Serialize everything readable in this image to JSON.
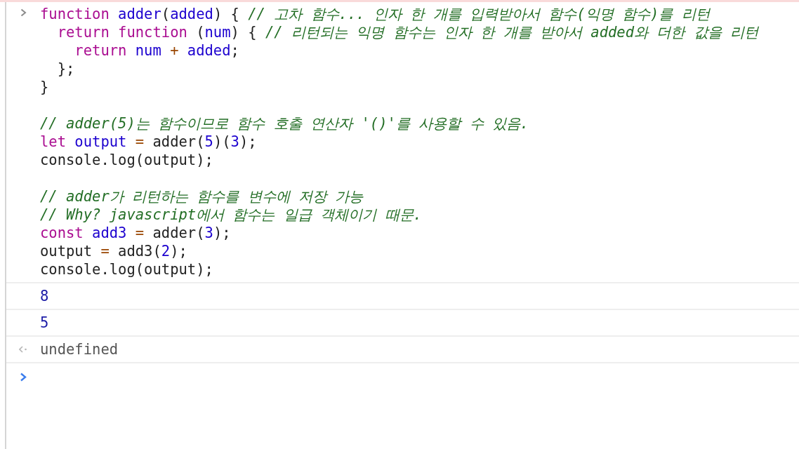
{
  "input": {
    "blocks": [
      [
        [
          {
            "kind": "keyword",
            "text": "function"
          },
          {
            "kind": "def",
            "text": " adder"
          },
          {
            "kind": "plain",
            "text": "("
          },
          {
            "kind": "def",
            "text": "added"
          },
          {
            "kind": "plain",
            "text": ") { "
          },
          {
            "kind": "comment",
            "text": "// 고차 함수... 인자 한 개를 입력받아서 함수(익명 함수)를 리턴"
          }
        ],
        [
          {
            "kind": "keyword",
            "text": "  return function"
          },
          {
            "kind": "plain",
            "text": " ("
          },
          {
            "kind": "def",
            "text": "num"
          },
          {
            "kind": "plain",
            "text": ") { "
          },
          {
            "kind": "comment",
            "text": "// 리턴되는 익명 함수는 인자 한 개를 받아서 added와 더한 값을 리턴"
          }
        ],
        [
          {
            "kind": "keyword",
            "text": "    return"
          },
          {
            "kind": "def",
            "text": " num"
          },
          {
            "kind": "operator",
            "text": " + "
          },
          {
            "kind": "def",
            "text": "added"
          },
          {
            "kind": "plain",
            "text": ";"
          }
        ],
        [
          {
            "kind": "plain",
            "text": "  };"
          }
        ],
        [
          {
            "kind": "plain",
            "text": "}"
          }
        ]
      ],
      [
        [
          {
            "kind": "comment",
            "text": "// adder(5)는 함수이므로 함수 호출 연산자 '()'를 사용할 수 있음."
          }
        ],
        [
          {
            "kind": "keyword",
            "text": "let"
          },
          {
            "kind": "def",
            "text": " output"
          },
          {
            "kind": "operator",
            "text": " = "
          },
          {
            "kind": "plain",
            "text": "adder("
          },
          {
            "kind": "number",
            "text": "5"
          },
          {
            "kind": "plain",
            "text": ")("
          },
          {
            "kind": "number",
            "text": "3"
          },
          {
            "kind": "plain",
            "text": ");"
          }
        ],
        [
          {
            "kind": "plain",
            "text": "console.log(output);"
          }
        ]
      ],
      [
        [
          {
            "kind": "comment",
            "text": "// adder가 리턴하는 함수를 변수에 저장 가능"
          }
        ],
        [
          {
            "kind": "comment",
            "text": "// Why? javascript에서 함수는 일급 객체이기 때문."
          }
        ],
        [
          {
            "kind": "keyword",
            "text": "const"
          },
          {
            "kind": "def",
            "text": " add3"
          },
          {
            "kind": "operator",
            "text": " = "
          },
          {
            "kind": "plain",
            "text": "adder("
          },
          {
            "kind": "number",
            "text": "3"
          },
          {
            "kind": "plain",
            "text": ");"
          }
        ],
        [
          {
            "kind": "plain",
            "text": "output"
          },
          {
            "kind": "operator",
            "text": " = "
          },
          {
            "kind": "plain",
            "text": "add3("
          },
          {
            "kind": "number",
            "text": "2"
          },
          {
            "kind": "plain",
            "text": ");"
          }
        ],
        [
          {
            "kind": "plain",
            "text": "console.log(output);"
          }
        ]
      ]
    ]
  },
  "messages": [
    {
      "kind": "log",
      "text": "8"
    },
    {
      "kind": "log",
      "text": "5"
    },
    {
      "kind": "result",
      "text": "undefined"
    }
  ]
}
